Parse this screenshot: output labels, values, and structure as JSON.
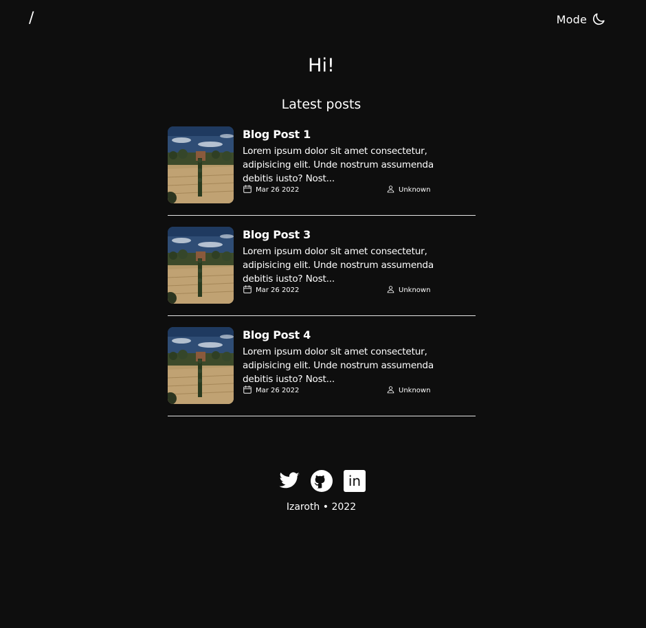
{
  "header": {
    "home_label": "/",
    "mode_label": "Mode",
    "mode_icon": "moon-icon"
  },
  "main": {
    "greeting": "Hi!",
    "section_title": "Latest posts",
    "posts": [
      {
        "title": "Blog Post 1",
        "excerpt": "Lorem ipsum dolor sit amet consectetur, adipisicing elit. Unde nostrum assumenda debitis iusto? Nost...",
        "date": "Mar 26 2022",
        "author": "Unknown",
        "thumbnail": "landscape-thumbnail"
      },
      {
        "title": "Blog Post 3",
        "excerpt": "Lorem ipsum dolor sit amet consectetur, adipisicing elit. Unde nostrum assumenda debitis iusto? Nost...",
        "date": "Mar 26 2022",
        "author": "Unknown",
        "thumbnail": "landscape-thumbnail"
      },
      {
        "title": "Blog Post 4",
        "excerpt": "Lorem ipsum dolor sit amet consectetur, adipisicing elit. Unde nostrum assumenda debitis iusto? Nost...",
        "date": "Mar 26 2022",
        "author": "Unknown",
        "thumbnail": "landscape-thumbnail"
      }
    ]
  },
  "footer": {
    "social": [
      "twitter-icon",
      "github-icon",
      "linkedin-icon"
    ],
    "linkedin_text": "in",
    "copyright": "Izaroth • 2022"
  },
  "colors": {
    "background": "#0e0e0e",
    "text": "#ffffff",
    "divider": "#e6e6e6"
  }
}
